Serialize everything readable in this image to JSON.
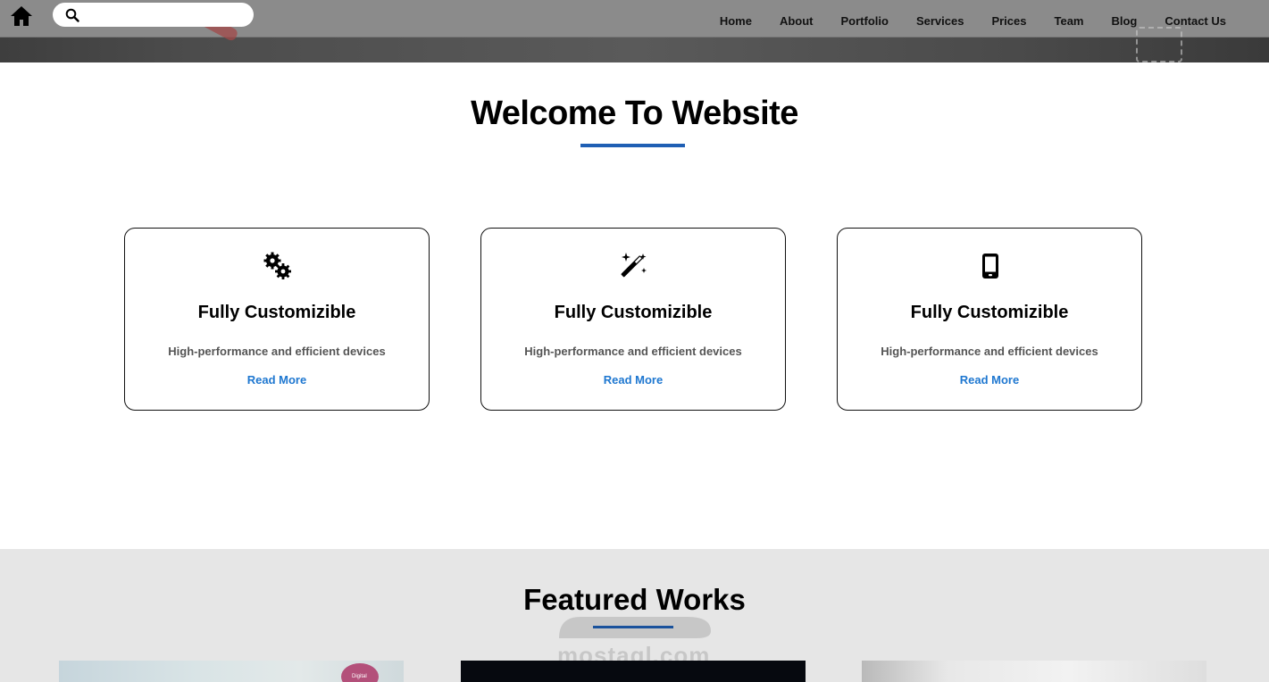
{
  "header": {
    "search": {
      "placeholder": "",
      "value": ""
    },
    "nav": [
      "Home",
      "About",
      "Portfolio",
      "Services",
      "Prices",
      "Team",
      "Blog",
      "Contact Us"
    ]
  },
  "welcome": {
    "title": "Welcome To Website",
    "cards": [
      {
        "icon": "gears-icon",
        "title": "Fully Customizible",
        "desc": "High-performance and efficient devices",
        "link": "Read More"
      },
      {
        "icon": "magic-wand-icon",
        "title": "Fully Customizible",
        "desc": "High-performance and efficient devices",
        "link": "Read More"
      },
      {
        "icon": "mobile-phone-icon",
        "title": "Fully Customizible",
        "desc": "High-performance and efficient devices",
        "link": "Read More"
      }
    ]
  },
  "featured": {
    "title": "Featured Works",
    "thumb1_caption": "Digital"
  },
  "watermark": {
    "text": "mostaql.com"
  },
  "colors": {
    "accent": "#1f5fb4",
    "link": "#1e77d0",
    "header": "#8b8b8b",
    "featured_bg": "#e6e6e6"
  }
}
